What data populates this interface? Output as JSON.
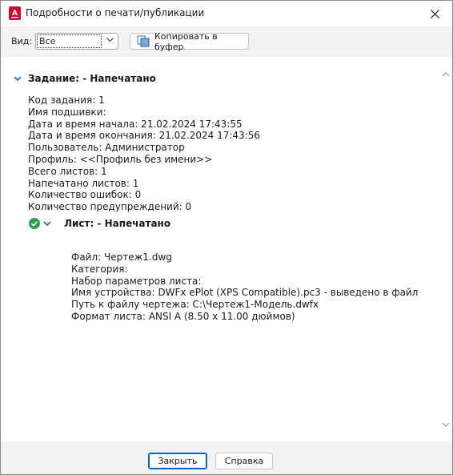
{
  "window": {
    "title": "Подробности о печати/публикации",
    "accent": "#c8102e"
  },
  "toolbar": {
    "view_label": "Вид:",
    "view_value": "Все",
    "copy_label": "Копировать в буфер"
  },
  "job": {
    "heading": "Задание: - Напечатано",
    "lines": [
      "Код задания: 1",
      "Имя подшивки:",
      "Дата и время начала: 21.02.2024 17:43:55",
      "Дата и время окончания: 21.02.2024 17:43:56",
      "Пользователь: Администратор",
      "Профиль: <<Профиль без имени>>",
      "Всего листов: 1",
      "Напечатано листов: 1",
      "Количество ошибок: 0",
      "Количество предупреждений: 0"
    ]
  },
  "sheet": {
    "heading": "Лист: - Напечатано",
    "status_color": "#2e9e4f",
    "lines": [
      "Файл: Чертеж1.dwg",
      "Категория:",
      "Набор параметров листа:",
      "Имя устройства: DWFx ePlot (XPS Compatible).pc3 - выведено в файл",
      "Путь к файлу чертежа: C:\\Чертеж1-Модель.dwfx",
      "Формат листа: ANSI A (8.50 x 11.00 дюймов)"
    ]
  },
  "footer": {
    "close_label": "Закрыть",
    "help_label": "Справка"
  }
}
